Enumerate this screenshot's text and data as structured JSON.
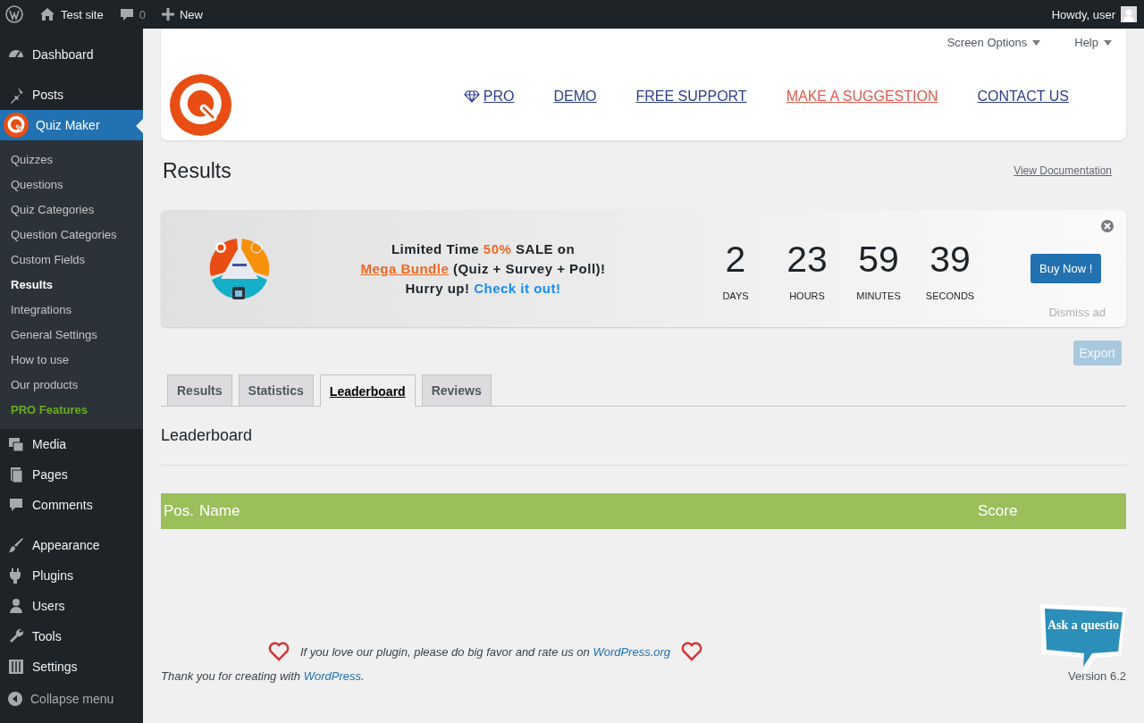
{
  "admin_bar": {
    "site": "Test site",
    "comments": "0",
    "new": "New",
    "greeting": "Howdy, user"
  },
  "sidebar": {
    "items": [
      {
        "label": "Dashboard",
        "selected": false
      },
      {
        "label": "Posts",
        "selected": false
      },
      {
        "label": "Quiz Maker",
        "selected": true,
        "children": [
          {
            "label": "Quizzes",
            "kind": "link",
            "selected": false
          },
          {
            "label": "Questions",
            "kind": "link",
            "selected": false
          },
          {
            "label": "Quiz Categories",
            "kind": "link",
            "selected": false
          },
          {
            "label": "Question Categories",
            "kind": "link",
            "selected": false
          },
          {
            "label": "Custom Fields",
            "kind": "link",
            "selected": false
          },
          {
            "label": "Results",
            "kind": "link",
            "selected": true
          },
          {
            "label": "Integrations",
            "kind": "link",
            "selected": false
          },
          {
            "label": "General Settings",
            "kind": "link",
            "selected": false
          },
          {
            "label": "How to use",
            "kind": "link",
            "selected": false
          },
          {
            "label": "Our products",
            "kind": "link",
            "selected": false
          },
          {
            "label": "PRO Features",
            "kind": "pro",
            "selected": false
          }
        ]
      },
      {
        "label": "Media",
        "selected": false
      },
      {
        "label": "Pages",
        "selected": false
      },
      {
        "label": "Comments",
        "selected": false
      },
      {
        "label": "Appearance",
        "selected": false
      },
      {
        "label": "Plugins",
        "selected": false
      },
      {
        "label": "Users",
        "selected": false
      },
      {
        "label": "Tools",
        "selected": false
      },
      {
        "label": "Settings",
        "selected": false
      }
    ],
    "collapse": "Collapse menu"
  },
  "screen_meta": [
    "Screen Options",
    "Help"
  ],
  "plugin_nav": [
    {
      "label": "PRO",
      "kind": "pro"
    },
    {
      "label": "DEMO",
      "kind": "link"
    },
    {
      "label": "FREE SUPPORT",
      "kind": "link"
    },
    {
      "label": "MAKE A SUGGESTION",
      "kind": "highlight"
    },
    {
      "label": "CONTACT US",
      "kind": "link"
    }
  ],
  "page_title": "Results",
  "doc_link": "View Documentation",
  "ad": {
    "lines": [
      [
        {
          "text": "Limited Time ",
          "kind": "plain"
        },
        {
          "text": "50%",
          "kind": "accent"
        },
        {
          "text": " SALE on",
          "kind": "plain"
        }
      ],
      [
        {
          "text": "Mega Bundle",
          "kind": "link"
        },
        {
          "text": " (Quiz + Survey + Poll)!",
          "kind": "plain"
        }
      ],
      [
        {
          "text": "Hurry up! ",
          "kind": "plain"
        },
        {
          "text": "Check it out!",
          "kind": "cta"
        }
      ]
    ],
    "countdown": [
      {
        "value": "2",
        "unit": "DAYS"
      },
      {
        "value": "23",
        "unit": "HOURS"
      },
      {
        "value": "59",
        "unit": "MINUTES"
      },
      {
        "value": "39",
        "unit": "SECONDS"
      }
    ],
    "buy": "Buy Now !",
    "dismiss": "Dismiss ad"
  },
  "export": {
    "label": "Export",
    "disabled": true
  },
  "tabs": [
    {
      "label": "Results",
      "selected": false
    },
    {
      "label": "Statistics",
      "selected": false
    },
    {
      "label": "Leaderboard",
      "selected": true
    },
    {
      "label": "Reviews",
      "selected": false
    }
  ],
  "section_title": "Leaderboard",
  "table": {
    "columns": [
      "Pos.",
      "Name",
      "Score"
    ]
  },
  "footer": {
    "rate_text": "If you love our plugin, please do big favor and rate us on ",
    "rate_link": "WordPress.org",
    "thanks": "Thank you for creating with ",
    "thanks_link": "WordPress",
    "thanks_end": ".",
    "version": "Version 6.2"
  },
  "ask_bubble": "Ask a questio"
}
